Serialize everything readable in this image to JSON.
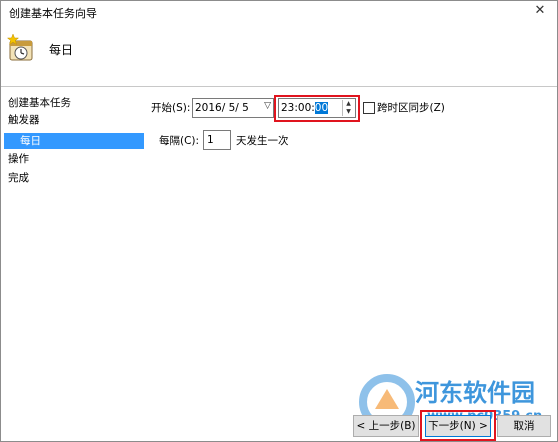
{
  "window": {
    "title": "创建基本任务向导",
    "close_glyph": "✕"
  },
  "header": {
    "title": "每日",
    "icon": "calendar-clock-icon"
  },
  "sidebar": {
    "items": [
      {
        "label": "创建基本任务",
        "selected": false
      },
      {
        "label": "触发器",
        "selected": false
      },
      {
        "label": "每日",
        "selected": true
      },
      {
        "label": "操作",
        "selected": false
      },
      {
        "label": "完成",
        "selected": false
      }
    ]
  },
  "form": {
    "start_label": "开始(S):",
    "date_value": "2016/ 5/ 5",
    "time_value_prefix": "23:00:",
    "time_value_selected": "00",
    "sync_timezone_label": "跨时区同步(Z)",
    "sync_timezone_checked": false,
    "every_label": "每隔(C):",
    "every_value": "1",
    "every_suffix": "天发生一次"
  },
  "buttons": {
    "back": "< 上一步(B)",
    "next": "下一步(N) >",
    "cancel": "取消"
  },
  "watermark": {
    "brand": "河东软件园",
    "url": "www.pc0359.cn"
  },
  "colors": {
    "selection": "#3399ff",
    "highlight_box": "#e0141e",
    "watermark": "#1d84d6"
  }
}
